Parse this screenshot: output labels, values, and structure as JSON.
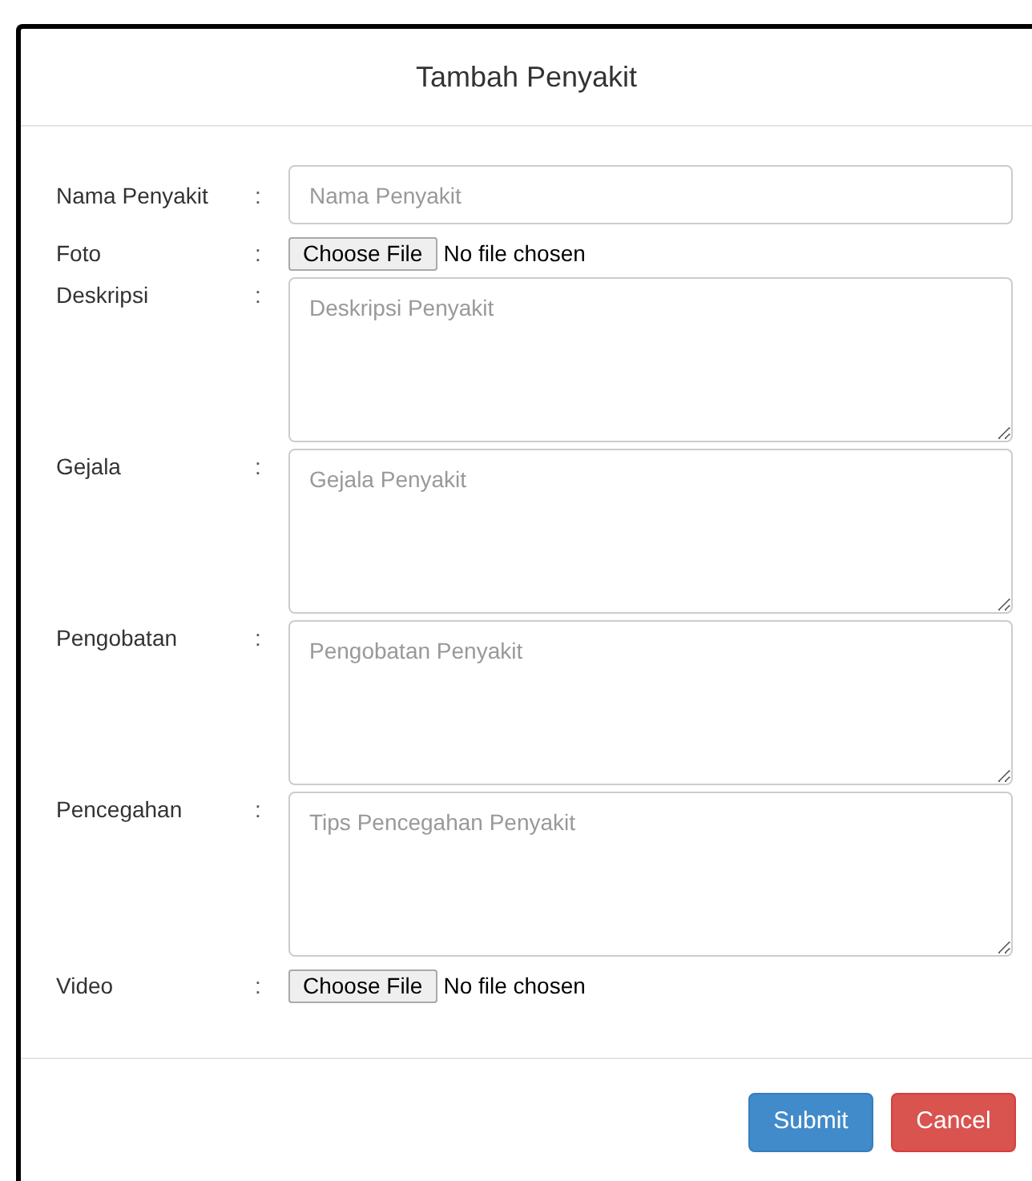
{
  "modal": {
    "title": "Tambah Penyakit",
    "fields": [
      {
        "kind": "text",
        "label": "Nama Penyakit",
        "separator": ":",
        "placeholder": "Nama Penyakit"
      },
      {
        "kind": "file",
        "label": "Foto",
        "separator": ":",
        "button": "Choose File",
        "status": "No file chosen"
      },
      {
        "kind": "textarea",
        "label": "Deskripsi",
        "separator": ":",
        "placeholder": "Deskripsi Penyakit"
      },
      {
        "kind": "textarea",
        "label": "Gejala",
        "separator": ":",
        "placeholder": "Gejala Penyakit"
      },
      {
        "kind": "textarea",
        "label": "Pengobatan",
        "separator": ":",
        "placeholder": "Pengobatan Penyakit"
      },
      {
        "kind": "textarea",
        "label": "Pencegahan",
        "separator": ":",
        "placeholder": "Tips Pencegahan Penyakit"
      },
      {
        "kind": "file",
        "label": "Video",
        "separator": ":",
        "button": "Choose File",
        "status": "No file chosen"
      }
    ],
    "buttons": [
      {
        "kind": "primary",
        "label": "Submit"
      },
      {
        "kind": "danger",
        "label": "Cancel"
      }
    ]
  }
}
